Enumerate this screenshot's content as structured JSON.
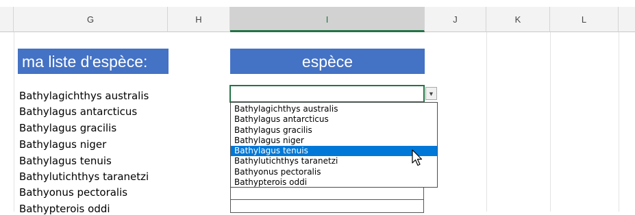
{
  "columns": [
    {
      "label": "G",
      "selected": false
    },
    {
      "label": "H",
      "selected": false
    },
    {
      "label": "I",
      "selected": true
    },
    {
      "label": "J",
      "selected": false
    },
    {
      "label": "K",
      "selected": false
    },
    {
      "label": "L",
      "selected": false
    }
  ],
  "left_title": "ma liste d'espèce:",
  "right_title": "espèce",
  "species_list": [
    "Bathylagichthys australis",
    "Bathylagus antarcticus",
    "Bathylagus gracilis",
    "Bathylagus niger",
    "Bathylagus tenuis",
    "Bathylutichthys taranetzi",
    "Bathyonus pectoralis",
    "Bathypterois oddi"
  ],
  "dropdown": {
    "items": [
      "Bathylagichthys australis",
      "Bathylagus antarcticus",
      "Bathylagus gracilis",
      "Bathylagus niger",
      "Bathylagus tenuis",
      "Bathylutichthys taranetzi",
      "Bathyonus pectoralis",
      "Bathypterois oddi"
    ],
    "highlighted_index": 4,
    "arrow_icon": "dropdown-arrow-icon"
  },
  "colors": {
    "title_bg": "#4472c4",
    "title_text": "#ffffff",
    "selection_accent": "#217346",
    "highlight_bg": "#0078d7"
  }
}
